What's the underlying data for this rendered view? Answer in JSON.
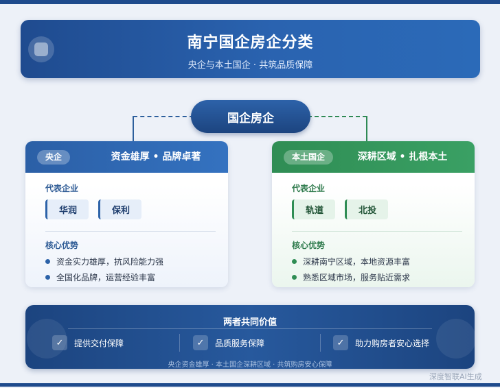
{
  "header": {
    "title": "南宁国企房企分类",
    "subtitle": "央企与本土国企 · 共筑品质保障"
  },
  "center": {
    "label": "国企房企"
  },
  "cards": [
    {
      "tag": "央企",
      "headline": "资金雄厚 • 品牌卓著",
      "rep_label": "代表企业",
      "companies": [
        "华润",
        "保利"
      ],
      "adv_label": "核心优势",
      "advantages": [
        "资金实力雄厚，抗风险能力强",
        "全国化品牌，运营经验丰富"
      ]
    },
    {
      "tag": "本土国企",
      "headline": "深耕区域 • 扎根本土",
      "rep_label": "代表企业",
      "companies": [
        "轨道",
        "北投"
      ],
      "adv_label": "核心优势",
      "advantages": [
        "深耕南宁区域，本地资源丰富",
        "熟悉区域市场，服务贴近需求"
      ]
    }
  ],
  "footer": {
    "title": "两者共同价值",
    "items": [
      "提供交付保障",
      "品质服务保障",
      "助力购房者安心选择"
    ],
    "check_icon": "✓",
    "caption": "央企资金雄厚 · 本土国企深耕区域 · 共筑购房安心保障"
  },
  "watermark": "深度智联AI生成",
  "colors": {
    "primary_blue": "#2b5fa6",
    "primary_green": "#2f8d54",
    "dark_navy": "#1c447f"
  }
}
